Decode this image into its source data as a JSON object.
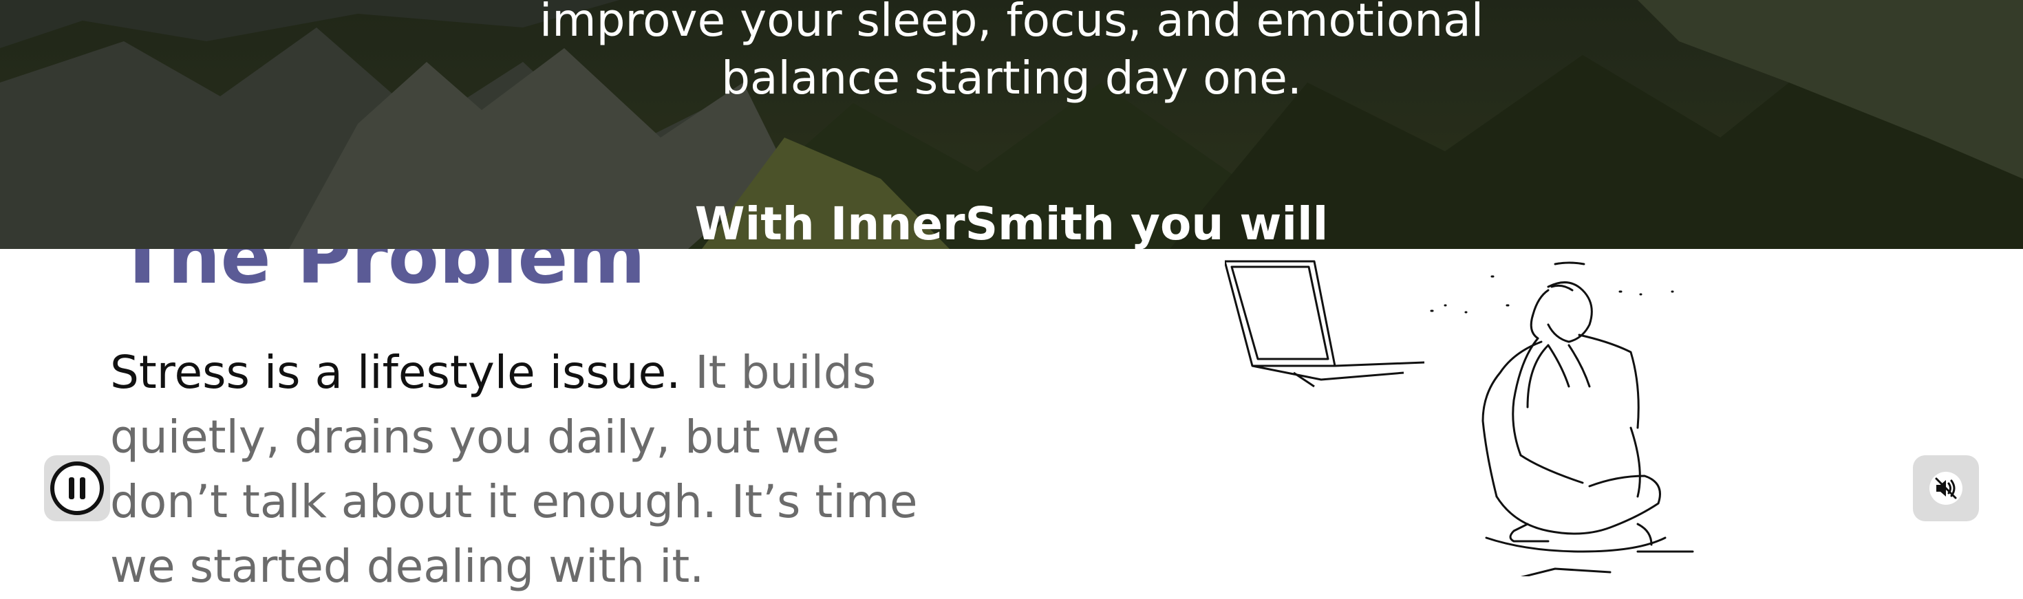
{
  "hero": {
    "subtitle_line1": "improve your sleep, focus, and emotional",
    "subtitle_line2": "balance starting day one.",
    "heading": "With InnerSmith you will"
  },
  "problem": {
    "title": "The Problem",
    "lead": "Stress is a lifestyle issue.",
    "body": " It builds quietly, drains you daily, but we don’t talk about it enough. It’s time we started dealing with it."
  },
  "controls": {
    "pause_icon": "pause-icon",
    "mute_icon": "speaker-muted-icon"
  },
  "colors": {
    "title_purple": "#5b5b96",
    "hero_overlay": "#2a3120"
  }
}
